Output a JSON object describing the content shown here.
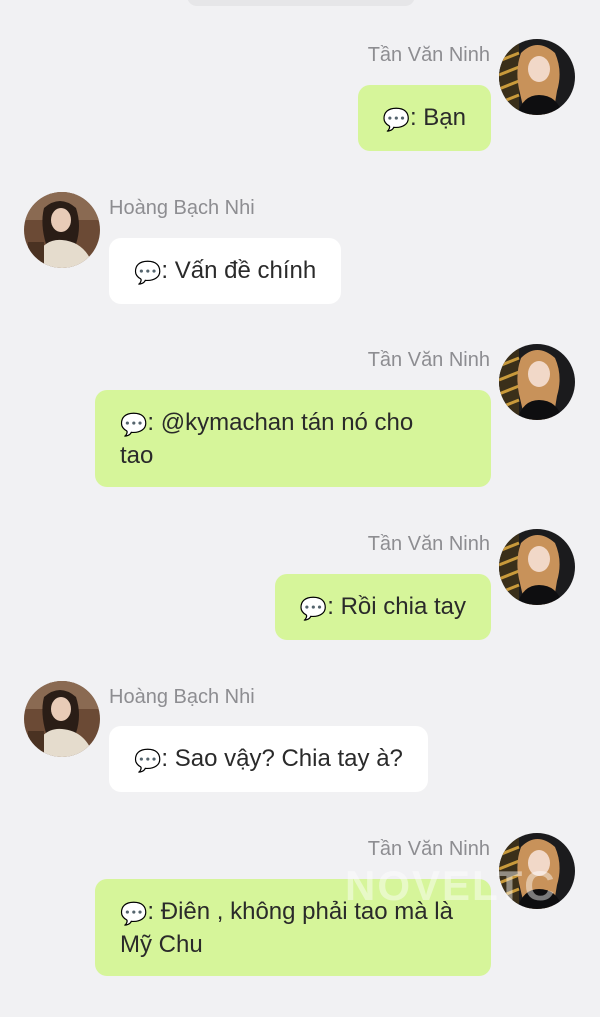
{
  "messages": [
    {
      "side": "right",
      "sender": "Tần Văn Ninh",
      "icon": "speech-bubble-icon",
      "text": ": Bạn"
    },
    {
      "side": "left",
      "sender": "Hoàng Bạch Nhi",
      "icon": "speech-bubble-icon",
      "text": ": Vấn đề chính"
    },
    {
      "side": "right",
      "sender": "Tần Văn Ninh",
      "icon": "speech-bubble-icon",
      "text": ": @kymachan tán nó cho tao"
    },
    {
      "side": "right",
      "sender": "Tần Văn Ninh",
      "icon": "speech-bubble-icon",
      "text": ": Rồi chia tay"
    },
    {
      "side": "left",
      "sender": "Hoàng Bạch Nhi",
      "icon": "speech-bubble-icon",
      "text": ": Sao vậy? Chia tay à?"
    },
    {
      "side": "right",
      "sender": "Tần Văn Ninh",
      "icon": "speech-bubble-icon",
      "text": ": Điên , không phải tao mà là Mỹ Chu"
    }
  ],
  "colors": {
    "background": "#f1f1f3",
    "right_bubble": "#d6f59a",
    "left_bubble": "#ffffff",
    "name_text": "#8d8d91"
  },
  "watermark": "NOVELTC"
}
